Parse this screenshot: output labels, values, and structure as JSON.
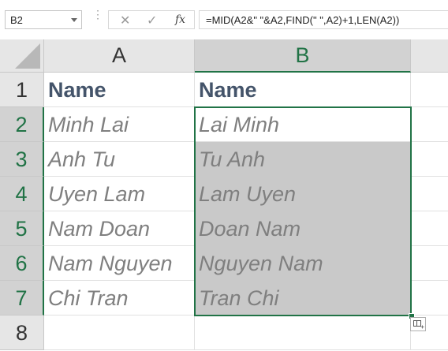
{
  "formula_bar": {
    "name_box": "B2",
    "cancel_symbol": "✕",
    "enter_symbol": "✓",
    "fx_symbol": "fx",
    "formula": "=MID(A2&\" \"&A2,FIND(\" \",A2)+1,LEN(A2))"
  },
  "columns": [
    "A",
    "B"
  ],
  "rows": [
    "1",
    "2",
    "3",
    "4",
    "5",
    "6",
    "7",
    "8"
  ],
  "cells": {
    "A": [
      "Name",
      "Minh Lai",
      "Anh Tu",
      "Uyen Lam",
      "Nam Doan",
      "Nam Nguyen",
      "Chi Tran",
      ""
    ],
    "B": [
      "Name",
      "Lai Minh",
      "Tu Anh",
      "Lam Uyen",
      "Doan Nam",
      "Nguyen Nam",
      "Tran Chi",
      ""
    ]
  },
  "selection": {
    "active_cell": "B2",
    "range": "B2:B7"
  },
  "colors": {
    "selection": "#217346",
    "header_text": "#44546a",
    "data_text": "#7f7f7f",
    "shade": "#c9c9c9"
  }
}
